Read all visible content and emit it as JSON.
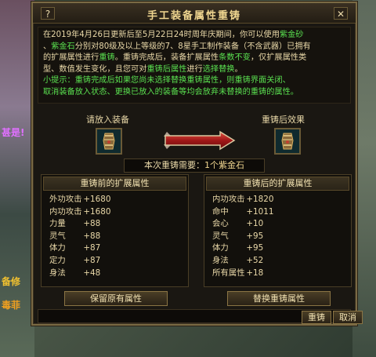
{
  "background": {
    "left_text_1": "甚是!",
    "left_text_2": "备修",
    "left_text_3": "毒菲"
  },
  "window": {
    "title": "手工装备属性重铸",
    "help_label": "?",
    "close_label": "✕"
  },
  "notice": {
    "line1_a": "在2019年4月26日更新后至5月22日24时周年庆期间，你可以使用",
    "line1_b": "紫金砂",
    "line2_a": "、",
    "line2_b": "紫金石",
    "line2_c": "分别对80级及以上等级的7、8星手工制作装备（不含武器）已拥有",
    "line3_a": "的扩展属性进行",
    "line3_b": "重铸",
    "line3_c": "。重铸完成后，装备扩展属性",
    "line3_d": "条数不变",
    "line3_e": "，仅扩展属性类",
    "line4_a": "型、数值发生变化，且您可对",
    "line4_b": "重铸后属性",
    "line4_c": "进行",
    "line4_d": "选择替换",
    "line4_e": "。",
    "hint1": "小提示：重铸完成后如果您尚未选择替换重铸属性，则重铸界面关闭、",
    "hint2": "取消装备放入状态、更换已放入的装备等均会放弃未替换的重铸的属性。"
  },
  "slots": {
    "input_label": "请放入装备",
    "result_label": "重铸后效果",
    "input_item_icon": "gauntlet-icon",
    "result_item_icon": "gauntlet-icon"
  },
  "cost": {
    "label": "本次重铸需要：",
    "value": "1个紫金石"
  },
  "before": {
    "title": "重铸前的扩展属性",
    "rows": [
      {
        "name": "外功攻击",
        "value": "+1680"
      },
      {
        "name": "内功攻击",
        "value": "+1680"
      },
      {
        "name": "力量",
        "value": "+88"
      },
      {
        "name": "灵气",
        "value": "+88"
      },
      {
        "name": "体力",
        "value": "+87"
      },
      {
        "name": "定力",
        "value": "+87"
      },
      {
        "name": "身法",
        "value": "+48"
      }
    ]
  },
  "after": {
    "title": "重铸后的扩展属性",
    "rows": [
      {
        "name": "内功攻击",
        "value": "+1820"
      },
      {
        "name": "命中",
        "value": "+1011"
      },
      {
        "name": "会心",
        "value": "+10"
      },
      {
        "name": "灵气",
        "value": "+95"
      },
      {
        "name": "体力",
        "value": "+95"
      },
      {
        "name": "身法",
        "value": "+52"
      },
      {
        "name": "所有属性",
        "value": "+18"
      }
    ]
  },
  "actions": {
    "keep_label": "保留原有属性",
    "replace_label": "替换重铸属性",
    "reforge_label": "重铸",
    "cancel_label": "取消"
  },
  "colors": {
    "text": "#e9d8a8",
    "highlight": "#5ae050",
    "title": "#f0d690",
    "border": "#7a6a44"
  }
}
